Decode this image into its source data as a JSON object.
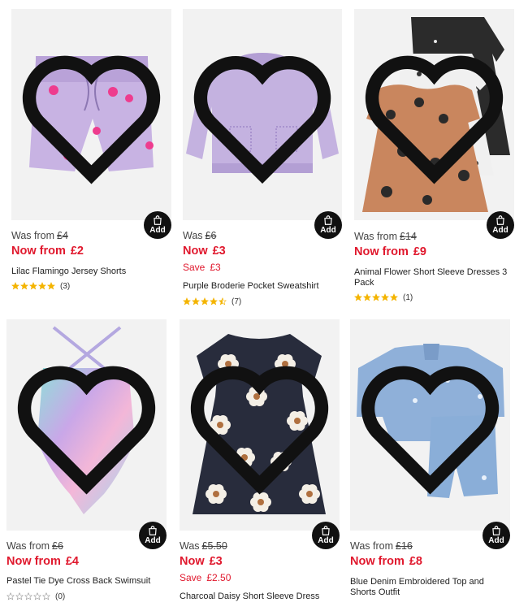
{
  "add_label": "Add",
  "products": [
    {
      "was_label": "Was from",
      "was_price": "£4",
      "now_label": "Now from",
      "now_price": "£2",
      "save_label": "",
      "save_amount": "",
      "title": "Lilac Flamingo Jersey Shorts",
      "rating": 5,
      "reviews": "(3)"
    },
    {
      "was_label": "Was",
      "was_price": "£6",
      "now_label": "Now",
      "now_price": "£3",
      "save_label": "Save",
      "save_amount": "£3",
      "title": "Purple Broderie Pocket Sweatshirt",
      "rating": 4.5,
      "reviews": "(7)"
    },
    {
      "was_label": "Was from",
      "was_price": "£14",
      "now_label": "Now from",
      "now_price": "£9",
      "save_label": "",
      "save_amount": "",
      "title": "Animal Flower Short Sleeve Dresses 3 Pack",
      "rating": 5,
      "reviews": "(1)"
    },
    {
      "was_label": "Was from",
      "was_price": "£6",
      "now_label": "Now from",
      "now_price": "£4",
      "save_label": "",
      "save_amount": "",
      "title": "Pastel Tie Dye Cross Back Swimsuit",
      "rating": 0,
      "reviews": "(0)"
    },
    {
      "was_label": "Was",
      "was_price": "£5.50",
      "now_label": "Now",
      "now_price": "£3",
      "save_label": "Save",
      "save_amount": "£2.50",
      "title": "Charcoal Daisy Short Sleeve Dress",
      "rating": null,
      "reviews": ""
    },
    {
      "was_label": "Was from",
      "was_price": "£16",
      "now_label": "Now from",
      "now_price": "£8",
      "save_label": "",
      "save_amount": "",
      "title": "Blue Denim Embroidered Top and Shorts Outfit",
      "rating": null,
      "reviews": ""
    }
  ],
  "colors": {
    "sale_red": "#e0182d",
    "star_gold": "#f4b400",
    "add_button": "#111111"
  }
}
